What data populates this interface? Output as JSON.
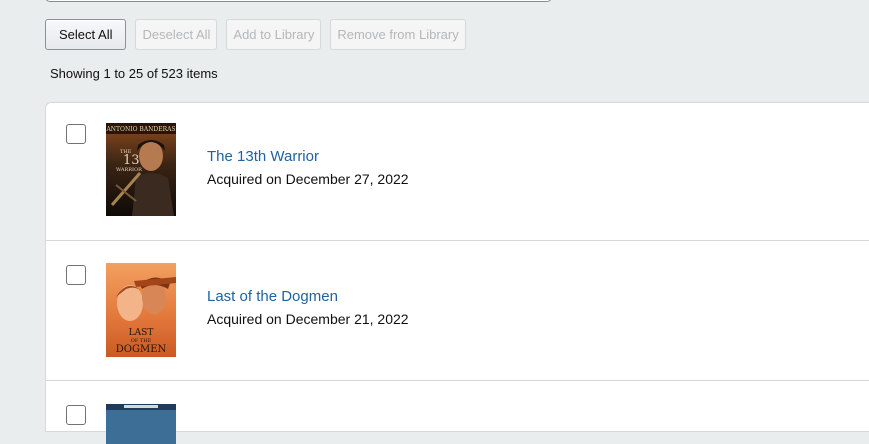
{
  "toolbar": {
    "select_all": "Select All",
    "deselect_all": "Deselect All",
    "add_to_library": "Add to Library",
    "remove_from_library": "Remove from Library"
  },
  "summary": "Showing 1 to 25 of 523 items",
  "colors": {
    "page_bg": "#eaeded",
    "link": "#2162a1",
    "disabled_text": "#b4b8b8"
  },
  "items": [
    {
      "title": "The 13th Warrior",
      "acquired": "Acquired on December 27, 2022",
      "poster_text": "ANTONIO BANDERAS THE 13TH WARRIOR"
    },
    {
      "title": "Last of the Dogmen",
      "acquired": "Acquired on December 21, 2022",
      "poster_text": "LAST OF THE DOGMEN"
    },
    {
      "title": "",
      "acquired": "",
      "poster_text": ""
    }
  ]
}
